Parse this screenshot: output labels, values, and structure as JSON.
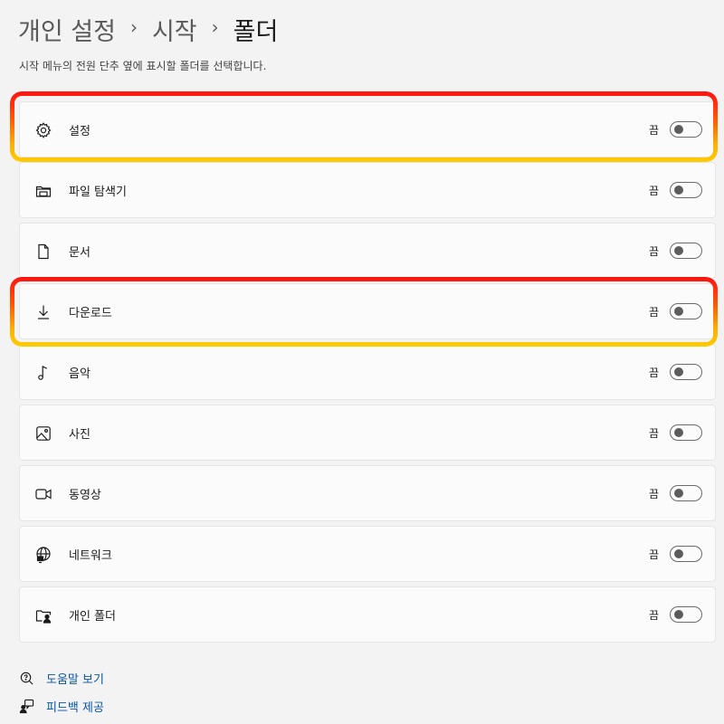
{
  "breadcrumb": {
    "items": [
      "개인 설정",
      "시작",
      "폴더"
    ],
    "separator": "›"
  },
  "subtitle": "시작 메뉴의 전원 단추 옆에 표시할 폴더를 선택합니다.",
  "folders": [
    {
      "label": "설정",
      "state": "끔",
      "icon": "gear-icon",
      "highlighted": true
    },
    {
      "label": "파일 탐색기",
      "state": "끔",
      "icon": "file-explorer-icon",
      "highlighted": false
    },
    {
      "label": "문서",
      "state": "끔",
      "icon": "document-icon",
      "highlighted": false
    },
    {
      "label": "다운로드",
      "state": "끔",
      "icon": "download-icon",
      "highlighted": true
    },
    {
      "label": "음악",
      "state": "끔",
      "icon": "music-icon",
      "highlighted": false
    },
    {
      "label": "사진",
      "state": "끔",
      "icon": "picture-icon",
      "highlighted": false
    },
    {
      "label": "동영상",
      "state": "끔",
      "icon": "video-icon",
      "highlighted": false
    },
    {
      "label": "네트워크",
      "state": "끔",
      "icon": "network-icon",
      "highlighted": false
    },
    {
      "label": "개인 폴더",
      "state": "끔",
      "icon": "personal-folder-icon",
      "highlighted": false
    }
  ],
  "links": {
    "help": {
      "label": "도움말 보기",
      "icon": "help-icon"
    },
    "feedback": {
      "label": "피드백 제공",
      "icon": "feedback-icon"
    }
  },
  "colors": {
    "highlight_top": "#ff1212",
    "highlight_bottom": "#ffcc00",
    "link": "#0a56a8"
  }
}
